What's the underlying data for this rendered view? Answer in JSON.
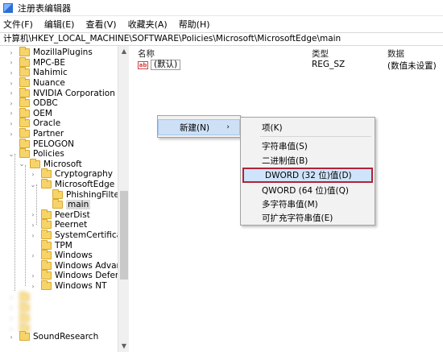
{
  "window": {
    "title": "注册表编辑器"
  },
  "menu": [
    "文件(F)",
    "编辑(E)",
    "查看(V)",
    "收藏夹(A)",
    "帮助(H)"
  ],
  "address": "计算机\\HKEY_LOCAL_MACHINE\\SOFTWARE\\Policies\\Microsoft\\MicrosoftEdge\\main",
  "tree": {
    "items": [
      {
        "label": "MozillaPlugins",
        "chev": "›"
      },
      {
        "label": "MPC-BE",
        "chev": "›"
      },
      {
        "label": "Nahimic",
        "chev": "›"
      },
      {
        "label": "Nuance",
        "chev": "›"
      },
      {
        "label": "NVIDIA Corporation",
        "chev": "›"
      },
      {
        "label": "ODBC",
        "chev": "›"
      },
      {
        "label": "OEM",
        "chev": "›"
      },
      {
        "label": "Oracle",
        "chev": "›"
      },
      {
        "label": "Partner",
        "chev": "›"
      },
      {
        "label": "PELOGON",
        "chev": ""
      },
      {
        "label": "Policies",
        "chev": "⌄"
      },
      {
        "label": "Microsoft",
        "chev": "⌄"
      },
      {
        "label": "Cryptography",
        "chev": "›"
      },
      {
        "label": "MicrosoftEdge",
        "chev": "⌄"
      },
      {
        "label": "PhishingFilter",
        "chev": ""
      },
      {
        "label": "main",
        "chev": ""
      },
      {
        "label": "PeerDist",
        "chev": "›"
      },
      {
        "label": "Peernet",
        "chev": "›"
      },
      {
        "label": "SystemCertificates",
        "chev": "›"
      },
      {
        "label": "TPM",
        "chev": ""
      },
      {
        "label": "Windows",
        "chev": "›"
      },
      {
        "label": "Windows Advanced",
        "chev": ""
      },
      {
        "label": "Windows Defender",
        "chev": "›"
      },
      {
        "label": "Windows NT",
        "chev": "›"
      },
      {
        "label": "SoundResearch",
        "chev": "›"
      }
    ]
  },
  "list": {
    "headers": {
      "name": "名称",
      "type": "类型",
      "data": "数据"
    },
    "row": {
      "name": "(默认)",
      "type": "REG_SZ",
      "data": "(数值未设置)",
      "icon": "ab"
    }
  },
  "context_menu_1": {
    "item": "新建(N)",
    "arrow": "›"
  },
  "context_menu_2": {
    "items": [
      "项(K)",
      "字符串值(S)",
      "二进制值(B)",
      "DWORD (32 位)值(D)",
      "QWORD (64 位)值(Q)",
      "多字符串值(M)",
      "可扩充字符串值(E)"
    ],
    "selected_index": 3
  },
  "colors": {
    "highlight_border": "#b1223a",
    "folder": "#f7d46a"
  }
}
